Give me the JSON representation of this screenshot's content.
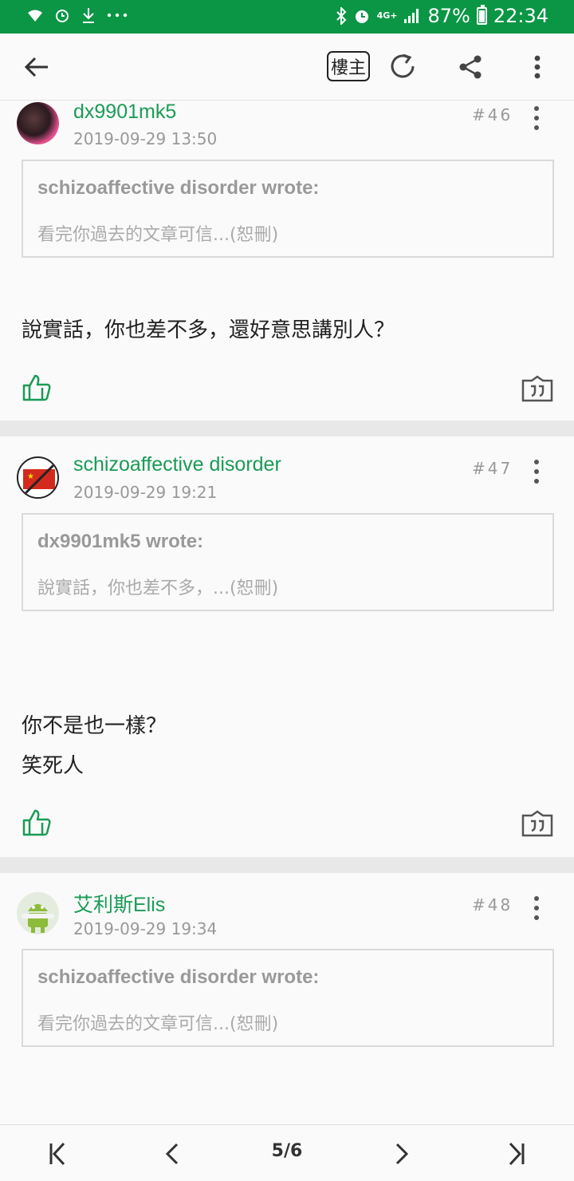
{
  "status_bar": {
    "network": "4G+",
    "battery": "87%",
    "time": "22:34",
    "background": "#0a9645"
  },
  "toolbar": {
    "op_label": "樓主",
    "icons": [
      "back-arrow-icon",
      "refresh-icon",
      "share-icon",
      "more-vert-icon"
    ]
  },
  "posts": [
    {
      "username": "dx9901mk5",
      "time": "2019-09-29 13:50",
      "number": "#46",
      "quote_author": "schizoaffective disorder wrote:",
      "quote_snippet": "看完你過去的文章可信...(恕刪)",
      "lines": [
        "說實話，你也差不多，還好意思講別人？"
      ]
    },
    {
      "username": "schizoaffective disorder",
      "time": "2019-09-29 19:21",
      "number": "#47",
      "quote_author": "dx9901mk5 wrote:",
      "quote_snippet": "說實話，你也差不多，...(恕刪)",
      "lines": [
        "你不是也一樣？",
        "笑死人"
      ]
    },
    {
      "username": "艾利斯Elis",
      "time": "2019-09-29 19:34",
      "number": "#48",
      "quote_author": "schizoaffective disorder wrote:",
      "quote_snippet": "看完你過去的文章可信...(恕刪)",
      "lines": []
    }
  ],
  "pagination": {
    "label": "5/6"
  },
  "colors": {
    "accent": "#1a9b56",
    "separator": "#e8e8e8"
  }
}
